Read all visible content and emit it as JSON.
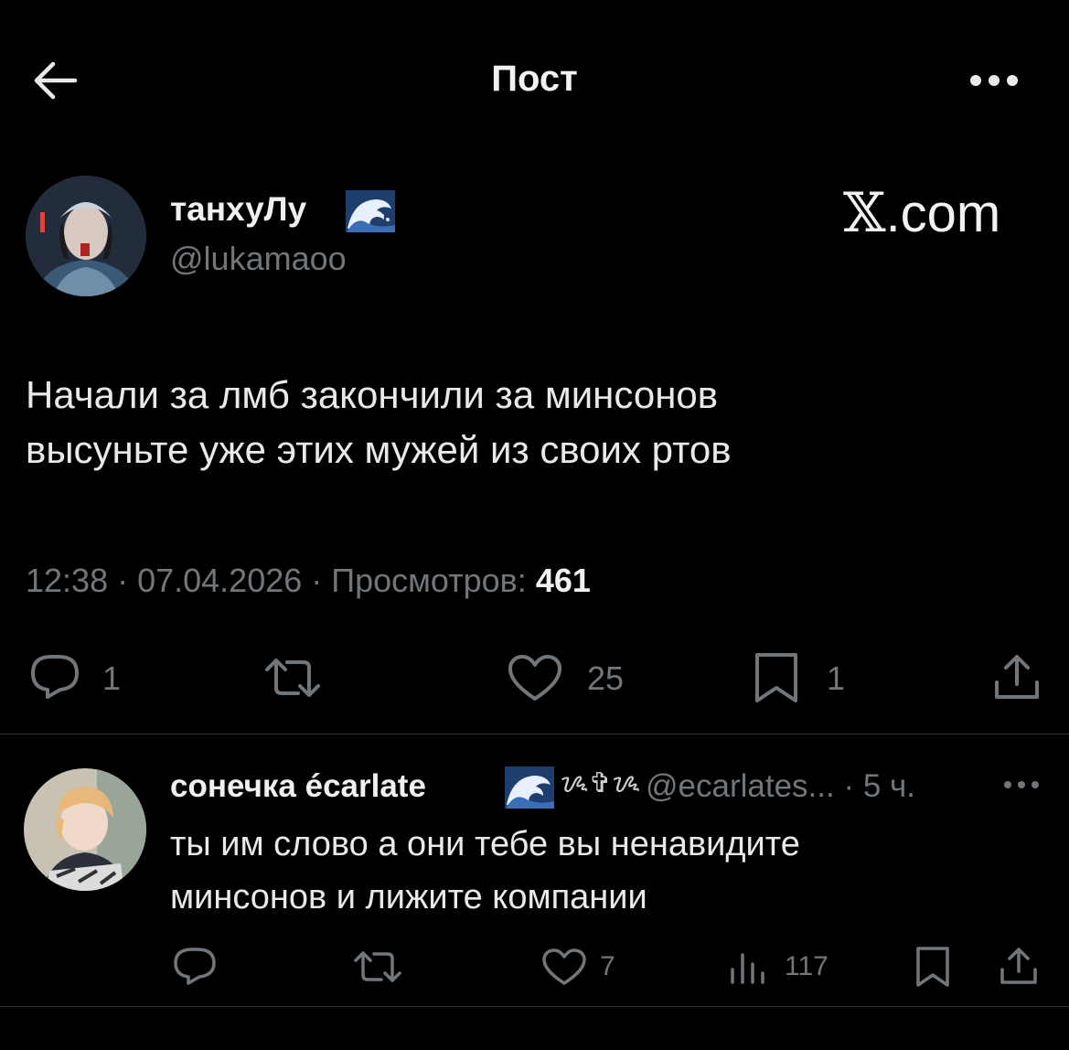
{
  "header": {
    "title": "Пост",
    "back_icon": "arrow-left-icon",
    "more_icon": "more-horizontal-icon"
  },
  "post": {
    "author": {
      "name": "танхуЛу",
      "name_emoji": "wave-icon",
      "handle": "@lukamaoo"
    },
    "brand": {
      "x": "𝕏",
      "rest": ".com"
    },
    "text_line1": "Начали за лмб закончили за минсонов",
    "text_line2": "высуньте уже этих мужей из своих ртов",
    "meta": {
      "time_date": "12:38 · 07.04.2026 · Просмотров: ",
      "views": "461"
    },
    "actions": {
      "replies": "1",
      "reposts": "",
      "likes": "25",
      "bookmarks": "1"
    }
  },
  "reply": {
    "author": {
      "name": "сонечка écarlate",
      "decoration": "ᝰ✞ᝰ",
      "handle": "@ecarlates...",
      "time": "· 5 ч."
    },
    "text_line1": "ты им слово а они тебе вы ненавидите",
    "text_line2": "минсонов и лижите компании",
    "actions": {
      "replies": "",
      "reposts": "",
      "likes": "7",
      "views": "117"
    }
  },
  "colors": {
    "background": "#000000",
    "text": "#e7e9ea",
    "secondary": "#71767b",
    "divider": "#2f3336"
  }
}
